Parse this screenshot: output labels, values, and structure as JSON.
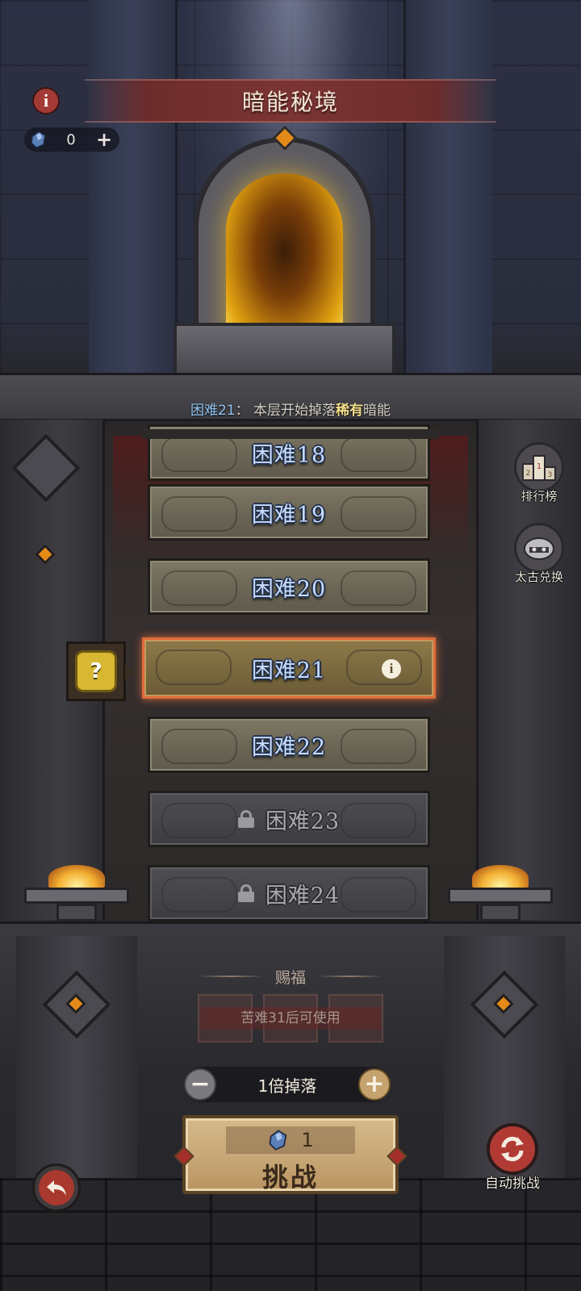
{
  "header": {
    "title": "暗能秘境",
    "info_icon": "info-icon",
    "currency": {
      "icon": "dark-crystal-icon",
      "amount": "0",
      "plus_icon": "plus-icon"
    }
  },
  "notice": {
    "level": "困难21",
    "sep": "：",
    "prefix": "本层开始掉落",
    "rare": "稀有",
    "suffix": "暗能"
  },
  "levels": [
    {
      "label": "困难18",
      "state": "unlocked"
    },
    {
      "label": "困难19",
      "state": "unlocked"
    },
    {
      "label": "困难20",
      "state": "unlocked"
    },
    {
      "label": "困难21",
      "state": "selected"
    },
    {
      "label": "困难22",
      "state": "unlocked"
    },
    {
      "label": "困难23",
      "state": "locked"
    },
    {
      "label": "困难24",
      "state": "locked"
    }
  ],
  "side_buttons": {
    "ranking": "排行榜",
    "exchange": "太古兑换"
  },
  "mystery_reward": {
    "symbol": "?"
  },
  "blessing": {
    "title": "赐福",
    "locked_text": "苦难31后可使用"
  },
  "multiplier": {
    "minus": "−",
    "label": "1倍掉落",
    "plus": "+"
  },
  "challenge": {
    "cost": "1",
    "label": "挑战"
  },
  "auto_challenge": {
    "label": "自动挑战"
  },
  "colors": {
    "accent_red": "#a43a35",
    "rare_gold": "#f3dc8a",
    "level_blue": "#c7dcff",
    "selected_border": "#e06a3a"
  }
}
